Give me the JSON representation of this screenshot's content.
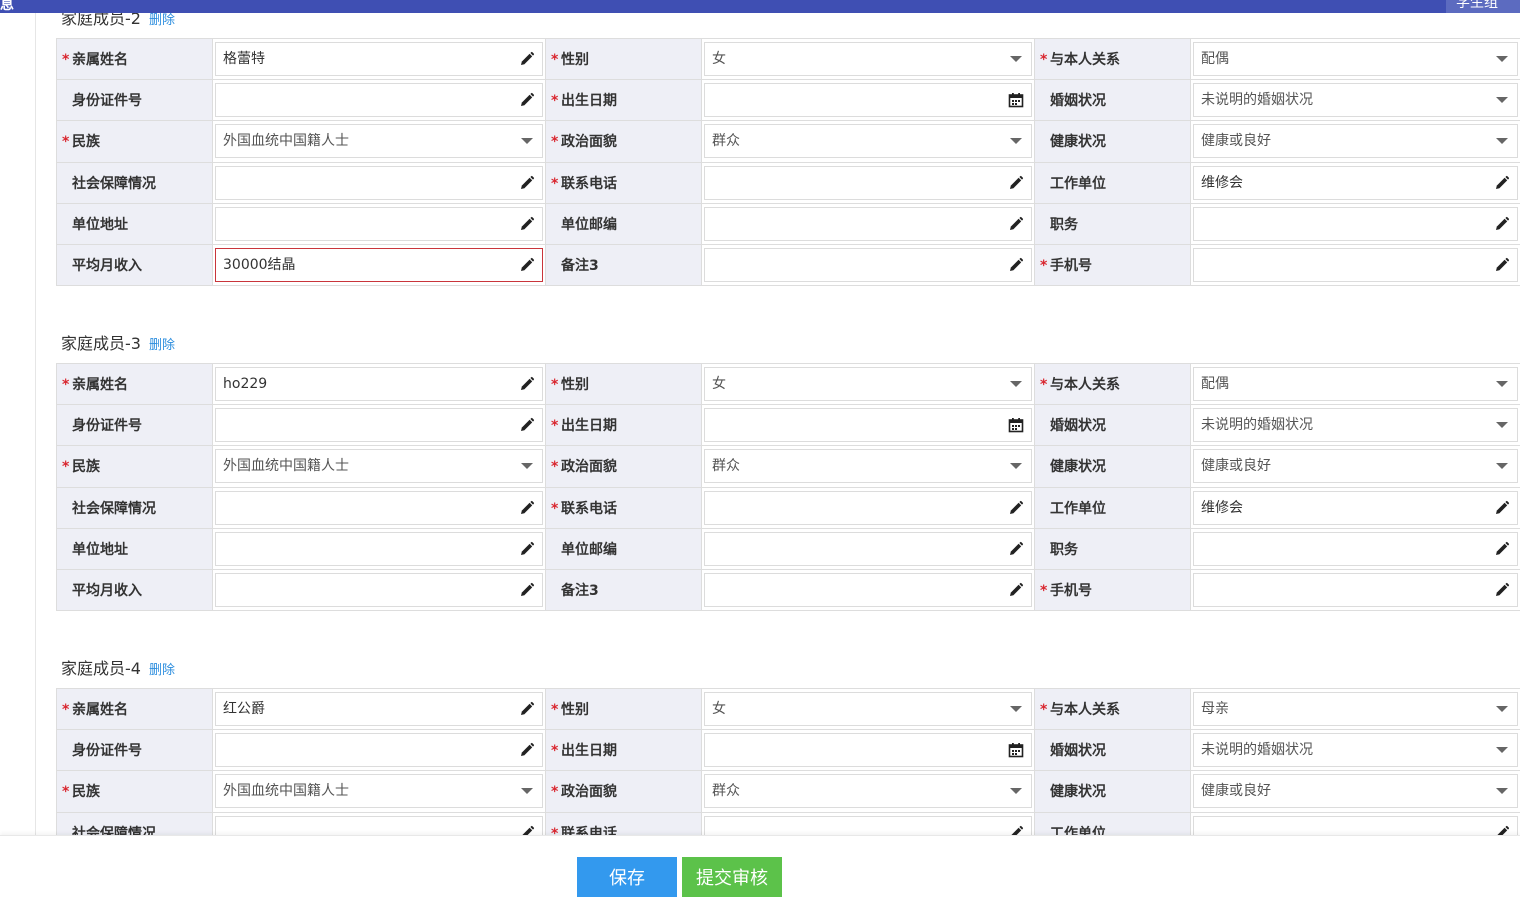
{
  "header": {
    "title_fragment": "息",
    "right_tag": "学生组"
  },
  "members": [
    {
      "title": "家庭成员-2",
      "delete_label": "删除",
      "rows": [
        [
          {
            "label": "亲属姓名",
            "required": true,
            "type": "text",
            "value": "格蕾特"
          },
          {
            "label": "性别",
            "required": true,
            "type": "select",
            "value": "女"
          },
          {
            "label": "与本人关系",
            "required": true,
            "type": "select",
            "value": "配偶"
          }
        ],
        [
          {
            "label": "身份证件号",
            "required": false,
            "type": "text",
            "value": ""
          },
          {
            "label": "出生日期",
            "required": true,
            "type": "date",
            "value": ""
          },
          {
            "label": "婚姻状况",
            "required": false,
            "type": "select",
            "value": "未说明的婚姻状况"
          }
        ],
        [
          {
            "label": "民族",
            "required": true,
            "type": "select",
            "value": "外国血统中国籍人士"
          },
          {
            "label": "政治面貌",
            "required": true,
            "type": "select",
            "value": "群众"
          },
          {
            "label": "健康状况",
            "required": false,
            "type": "select",
            "value": "健康或良好"
          }
        ],
        [
          {
            "label": "社会保障情况",
            "required": false,
            "type": "text",
            "value": ""
          },
          {
            "label": "联系电话",
            "required": true,
            "type": "text",
            "value": ""
          },
          {
            "label": "工作单位",
            "required": false,
            "type": "text",
            "value": "维修会"
          }
        ],
        [
          {
            "label": "单位地址",
            "required": false,
            "type": "text",
            "value": ""
          },
          {
            "label": "单位邮编",
            "required": false,
            "type": "text",
            "value": ""
          },
          {
            "label": "职务",
            "required": false,
            "type": "text",
            "value": ""
          }
        ],
        [
          {
            "label": "平均月收入",
            "required": false,
            "type": "text",
            "value": "30000结晶",
            "error": true
          },
          {
            "label": "备注3",
            "required": false,
            "type": "text",
            "value": ""
          },
          {
            "label": "手机号",
            "required": true,
            "type": "text",
            "value": ""
          }
        ]
      ]
    },
    {
      "title": "家庭成员-3",
      "delete_label": "删除",
      "rows": [
        [
          {
            "label": "亲属姓名",
            "required": true,
            "type": "text",
            "value": "ho229"
          },
          {
            "label": "性别",
            "required": true,
            "type": "select",
            "value": "女"
          },
          {
            "label": "与本人关系",
            "required": true,
            "type": "select",
            "value": "配偶"
          }
        ],
        [
          {
            "label": "身份证件号",
            "required": false,
            "type": "text",
            "value": ""
          },
          {
            "label": "出生日期",
            "required": true,
            "type": "date",
            "value": ""
          },
          {
            "label": "婚姻状况",
            "required": false,
            "type": "select",
            "value": "未说明的婚姻状况"
          }
        ],
        [
          {
            "label": "民族",
            "required": true,
            "type": "select",
            "value": "外国血统中国籍人士"
          },
          {
            "label": "政治面貌",
            "required": true,
            "type": "select",
            "value": "群众"
          },
          {
            "label": "健康状况",
            "required": false,
            "type": "select",
            "value": "健康或良好"
          }
        ],
        [
          {
            "label": "社会保障情况",
            "required": false,
            "type": "text",
            "value": ""
          },
          {
            "label": "联系电话",
            "required": true,
            "type": "text",
            "value": ""
          },
          {
            "label": "工作单位",
            "required": false,
            "type": "text",
            "value": "维修会"
          }
        ],
        [
          {
            "label": "单位地址",
            "required": false,
            "type": "text",
            "value": ""
          },
          {
            "label": "单位邮编",
            "required": false,
            "type": "text",
            "value": ""
          },
          {
            "label": "职务",
            "required": false,
            "type": "text",
            "value": ""
          }
        ],
        [
          {
            "label": "平均月收入",
            "required": false,
            "type": "text",
            "value": ""
          },
          {
            "label": "备注3",
            "required": false,
            "type": "text",
            "value": ""
          },
          {
            "label": "手机号",
            "required": true,
            "type": "text",
            "value": ""
          }
        ]
      ]
    },
    {
      "title": "家庭成员-4",
      "delete_label": "删除",
      "rows": [
        [
          {
            "label": "亲属姓名",
            "required": true,
            "type": "text",
            "value": "红公爵"
          },
          {
            "label": "性别",
            "required": true,
            "type": "select",
            "value": "女"
          },
          {
            "label": "与本人关系",
            "required": true,
            "type": "select",
            "value": "母亲"
          }
        ],
        [
          {
            "label": "身份证件号",
            "required": false,
            "type": "text",
            "value": ""
          },
          {
            "label": "出生日期",
            "required": true,
            "type": "date",
            "value": ""
          },
          {
            "label": "婚姻状况",
            "required": false,
            "type": "select",
            "value": "未说明的婚姻状况"
          }
        ],
        [
          {
            "label": "民族",
            "required": true,
            "type": "select",
            "value": "外国血统中国籍人士"
          },
          {
            "label": "政治面貌",
            "required": true,
            "type": "select",
            "value": "群众"
          },
          {
            "label": "健康状况",
            "required": false,
            "type": "select",
            "value": "健康或良好"
          }
        ],
        [
          {
            "label": "社会保障情况",
            "required": false,
            "type": "text",
            "value": ""
          },
          {
            "label": "联系电话",
            "required": true,
            "type": "text",
            "value": ""
          },
          {
            "label": "工作单位",
            "required": false,
            "type": "text",
            "value": ""
          }
        ]
      ]
    }
  ],
  "footer": {
    "save_label": "保存",
    "submit_label": "提交审核"
  },
  "colors": {
    "header_bar": "#3f4fb3",
    "label_bg": "#eeeff6",
    "required_mark": "#d9262f",
    "delete_link": "#2b8dde",
    "save_button": "#3399ee",
    "submit_button": "#5cc24a",
    "error_border": "#c9353b"
  }
}
